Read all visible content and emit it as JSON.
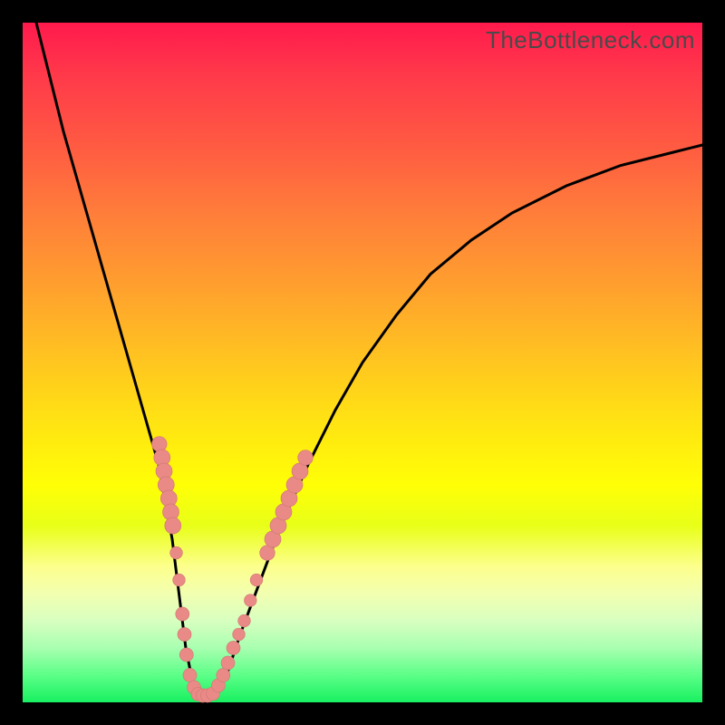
{
  "watermark": "TheBottleneck.com",
  "colors": {
    "frame": "#000000",
    "curve": "#000000",
    "bead": "#e98a87",
    "gradient_top": "#ff1a4d",
    "gradient_bottom": "#18f060"
  },
  "chart_data": {
    "type": "line",
    "title": "",
    "xlabel": "",
    "ylabel": "",
    "xlim": [
      0,
      100
    ],
    "ylim": [
      0,
      100
    ],
    "legend": false,
    "grid": false,
    "annotations": [
      "TheBottleneck.com"
    ],
    "series": [
      {
        "name": "bottleneck-curve",
        "x": [
          2,
          4,
          6,
          8,
          10,
          12,
          14,
          16,
          18,
          20,
          22,
          23,
          24,
          25,
          26,
          28,
          30,
          32,
          35,
          38,
          42,
          46,
          50,
          55,
          60,
          66,
          72,
          80,
          88,
          96,
          100
        ],
        "values": [
          100,
          92,
          84,
          77,
          70,
          63,
          56,
          49,
          42,
          35,
          24,
          16,
          8,
          3,
          1,
          1,
          4,
          10,
          18,
          26,
          35,
          43,
          50,
          57,
          63,
          68,
          72,
          76,
          79,
          81,
          82
        ]
      }
    ],
    "beads_left": [
      {
        "x": 20.1,
        "y": 38,
        "r": 1.1
      },
      {
        "x": 20.5,
        "y": 36,
        "r": 1.2
      },
      {
        "x": 20.8,
        "y": 34,
        "r": 1.2
      },
      {
        "x": 21.1,
        "y": 32,
        "r": 1.2
      },
      {
        "x": 21.5,
        "y": 30,
        "r": 1.2
      },
      {
        "x": 21.8,
        "y": 28,
        "r": 1.2
      },
      {
        "x": 22.1,
        "y": 26,
        "r": 1.2
      },
      {
        "x": 22.6,
        "y": 22,
        "r": 0.9
      },
      {
        "x": 23.0,
        "y": 18,
        "r": 0.9
      },
      {
        "x": 23.5,
        "y": 13,
        "r": 1.0
      },
      {
        "x": 23.8,
        "y": 10,
        "r": 1.0
      },
      {
        "x": 24.1,
        "y": 7,
        "r": 1.0
      },
      {
        "x": 24.6,
        "y": 4,
        "r": 1.0
      },
      {
        "x": 25.2,
        "y": 2.2,
        "r": 1.0
      },
      {
        "x": 25.8,
        "y": 1.2,
        "r": 1.0
      },
      {
        "x": 26.5,
        "y": 1.0,
        "r": 1.0
      },
      {
        "x": 27.2,
        "y": 1.0,
        "r": 1.0
      }
    ],
    "beads_right": [
      {
        "x": 28.0,
        "y": 1.3,
        "r": 1.0
      },
      {
        "x": 28.8,
        "y": 2.5,
        "r": 1.0
      },
      {
        "x": 29.5,
        "y": 4.0,
        "r": 1.0
      },
      {
        "x": 30.2,
        "y": 5.8,
        "r": 1.0
      },
      {
        "x": 31.0,
        "y": 8.0,
        "r": 1.0
      },
      {
        "x": 31.8,
        "y": 10.0,
        "r": 0.9
      },
      {
        "x": 32.6,
        "y": 12.0,
        "r": 0.9
      },
      {
        "x": 33.5,
        "y": 15.0,
        "r": 0.9
      },
      {
        "x": 34.4,
        "y": 18.0,
        "r": 0.9
      },
      {
        "x": 36.0,
        "y": 22.0,
        "r": 1.1
      },
      {
        "x": 36.8,
        "y": 24.0,
        "r": 1.2
      },
      {
        "x": 37.6,
        "y": 26.0,
        "r": 1.2
      },
      {
        "x": 38.4,
        "y": 28.0,
        "r": 1.2
      },
      {
        "x": 39.2,
        "y": 30.0,
        "r": 1.2
      },
      {
        "x": 40.0,
        "y": 32.0,
        "r": 1.2
      },
      {
        "x": 40.8,
        "y": 34.0,
        "r": 1.2
      },
      {
        "x": 41.6,
        "y": 36.0,
        "r": 1.1
      }
    ]
  }
}
